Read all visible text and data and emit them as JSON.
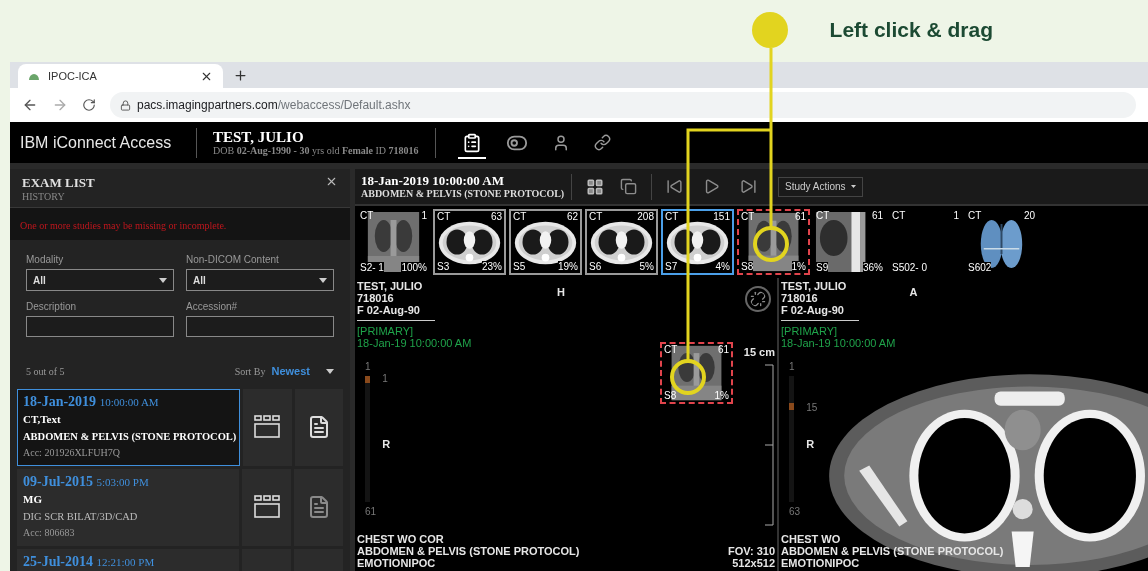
{
  "annotation": {
    "label": "Left click & drag"
  },
  "browser": {
    "tab": {
      "title": "IPOC-ICA"
    },
    "url_host": "pacs.imagingpartners.com",
    "url_path": "/webaccess/Default.ashx"
  },
  "app": {
    "title": "IBM iConnect Access",
    "patient": {
      "name": "TEST, JULIO",
      "details": "DOB **02-Aug-1990 - 30** yrs old **Female** ID **718016**"
    },
    "tools": [
      {
        "kind": "report",
        "selected": true
      },
      {
        "kind": "toggle",
        "selected": false
      },
      {
        "kind": "person",
        "selected": false
      },
      {
        "kind": "link",
        "selected": false
      }
    ]
  },
  "exam_list": {
    "title": "EXAM LIST",
    "subtitle": "HISTORY",
    "warning": "One or more studies may be missing or incomplete.",
    "filters": [
      {
        "kind": "select",
        "label": "Modality",
        "value": "All"
      },
      {
        "kind": "select",
        "label": "Non-DICOM Content",
        "value": "All"
      },
      {
        "kind": "text",
        "label": "Description"
      },
      {
        "kind": "text",
        "label": "Accession#"
      }
    ],
    "count": "5 out of 5",
    "sort_label": "Sort By",
    "sort_value": "Newest",
    "exams": [
      {
        "date": "18-Jan-2019",
        "time": "10:00:00 AM",
        "modality": "CT,Text",
        "description": "ABDOMEN & PELVIS (STONE PROTOCOL)",
        "accession": "Acc: 201926XLFUH7Q",
        "selected": true,
        "report_available": true
      },
      {
        "date": "09-Jul-2015",
        "time": "5:03:00 PM",
        "modality": "MG",
        "description": "DIG SCR BILAT/3D/CAD",
        "accession": "Acc: 806683",
        "selected": false,
        "report_available": false
      },
      {
        "date": "25-Jul-2014",
        "time": "12:21:00 PM",
        "selected": false
      }
    ]
  },
  "viewer": {
    "study_date": "18-Jan-2019 10:00:00 AM",
    "study_desc": "ABDOMEN & PELVIS (STONE PROTOCOL)",
    "tools": [
      {
        "kind": "layout",
        "selected": true
      },
      {
        "kind": "windows",
        "selected": false
      },
      {
        "kind": "first",
        "selected": false
      },
      {
        "kind": "play",
        "selected": false
      },
      {
        "kind": "last",
        "selected": false
      }
    ],
    "actions": "Study Actions",
    "thumbnails": [
      {
        "kind": "coronal",
        "modality": "CT",
        "count": "1",
        "series": "S2- 1",
        "percent": "100%",
        "framed": false,
        "selected": false,
        "dragged": false
      },
      {
        "kind": "axial",
        "modality": "CT",
        "count": "63",
        "series": "S3",
        "percent": "23%",
        "framed": true,
        "selected": false,
        "dragged": false
      },
      {
        "kind": "axial",
        "modality": "CT",
        "count": "62",
        "series": "S5",
        "percent": "19%",
        "framed": true,
        "selected": false,
        "dragged": false
      },
      {
        "kind": "axial",
        "modality": "CT",
        "count": "208",
        "series": "S6",
        "percent": "5%",
        "framed": true,
        "selected": false,
        "dragged": false
      },
      {
        "kind": "axial",
        "modality": "CT",
        "count": "151",
        "series": "S7",
        "percent": "4%",
        "framed": true,
        "selected": true,
        "dragged": false
      },
      {
        "kind": "coronal",
        "modality": "CT",
        "count": "61",
        "series": "S8",
        "percent": "1%",
        "framed": true,
        "selected": false,
        "dragged": true
      },
      {
        "kind": "sagittal",
        "modality": "CT",
        "count": "61",
        "series": "S9",
        "percent": "36%",
        "framed": false,
        "selected": false,
        "dragged": false
      },
      {
        "kind": "none",
        "modality": "CT",
        "count": "1",
        "series": "S502- 0",
        "framed": false,
        "selected": false,
        "dragged": false
      },
      {
        "kind": "volume",
        "modality": "CT",
        "count": "20",
        "series": "S602",
        "framed": false,
        "selected": false,
        "dragged": false
      }
    ],
    "panes": [
      {
        "patient_lines": [
          "TEST, JULIO",
          "718016",
          "F 02-Aug-90"
        ],
        "tag": "[PRIMARY]",
        "datetime": "18-Jan-19 10:00:00 AM",
        "orientation_top": "H",
        "orientation_left": "R",
        "slice_first": "1",
        "slice_current": "1",
        "slice_last": "61",
        "desc_lines": [
          "CHEST WO COR",
          "ABDOMEN & PELVIS (STONE PROTOCOL)",
          "EMOTIONIPOC"
        ],
        "scale": "15 cm",
        "fov_lines": [
          "FOV: 310",
          "512x512"
        ],
        "unlinked": true,
        "image": false,
        "drop": {
          "modality": "CT",
          "count": "61",
          "series": "S8",
          "percent": "1%"
        }
      },
      {
        "patient_lines": [
          "TEST, JULIO",
          "718016",
          "F 02-Aug-90"
        ],
        "tag": "[PRIMARY]",
        "datetime": "18-Jan-19 10:00:00 AM",
        "orientation_top": "A",
        "orientation_left": "R",
        "slice_first": "1",
        "slice_current": "15",
        "slice_last": "63",
        "desc_lines": [
          "CHEST WO",
          "ABDOMEN & PELVIS (STONE PROTOCOL)",
          "EMOTIONIPOC"
        ],
        "unlinked": false,
        "image": true
      }
    ]
  }
}
